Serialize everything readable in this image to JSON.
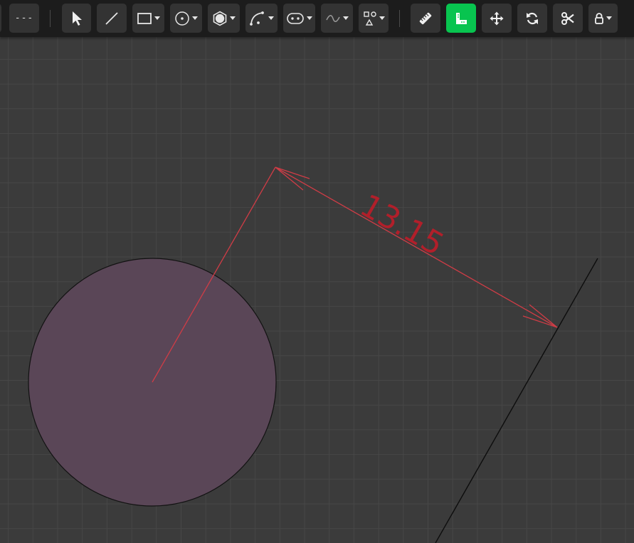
{
  "toolbar": {
    "line_style_label": "---",
    "tools": [
      {
        "name": "select-tool",
        "icon": "cursor-arrow-icon"
      },
      {
        "name": "line-tool",
        "icon": "line-icon"
      },
      {
        "name": "rectangle-tool",
        "icon": "rectangle-icon",
        "has_menu": true
      },
      {
        "name": "circle-tool",
        "icon": "circle-icon",
        "has_menu": true
      },
      {
        "name": "polygon-tool",
        "icon": "hexagon-icon",
        "has_menu": true
      },
      {
        "name": "arc-tool",
        "icon": "arc-icon",
        "has_menu": true
      },
      {
        "name": "slot-tool",
        "icon": "slot-icon",
        "has_menu": true
      },
      {
        "name": "spline-tool",
        "icon": "spline-icon",
        "has_menu": true
      },
      {
        "name": "shapes-tool",
        "icon": "shapes-icon",
        "has_menu": true
      },
      {
        "name": "measure-tool",
        "icon": "ruler-icon"
      },
      {
        "name": "dimension-tool",
        "icon": "dimension-icon",
        "active": true
      },
      {
        "name": "move-tool",
        "icon": "move-arrows-icon"
      },
      {
        "name": "rotate-tool",
        "icon": "rotate-icon"
      },
      {
        "name": "trim-tool",
        "icon": "scissors-icon"
      },
      {
        "name": "lock-tool",
        "icon": "lock-icon",
        "has_menu": true
      }
    ],
    "active_color": "#08c44f"
  },
  "canvas": {
    "background_color": "#3b3b3b",
    "grid_color": "#474747",
    "circle_fill": "#5a4657",
    "dimension_color": "#d03c46",
    "dimension_value": "13.15"
  }
}
